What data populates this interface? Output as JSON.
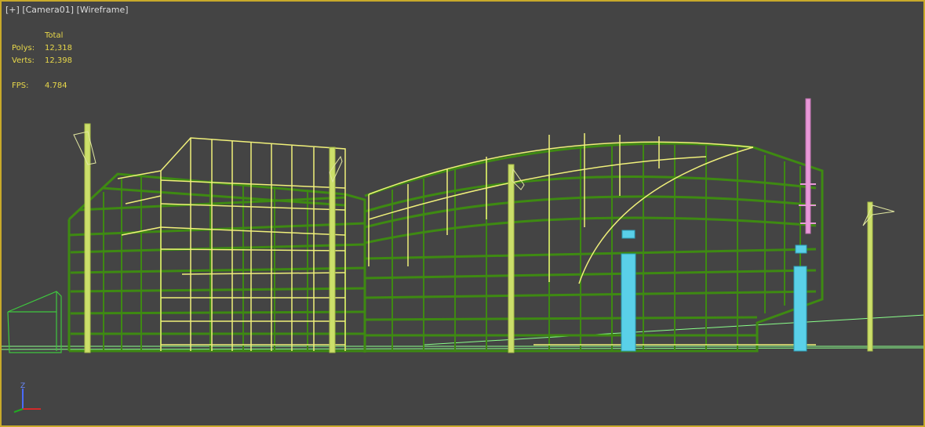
{
  "viewport": {
    "label_plus": "[+]",
    "label_camera": "[Camera01]",
    "label_mode": "[Wireframe]"
  },
  "stats": {
    "header": "Total",
    "polys_label": "Polys:",
    "polys_value": "12,318",
    "verts_label": "Verts:",
    "verts_value": "12,398",
    "fps_label": "FPS:",
    "fps_value": "4.784"
  },
  "colors": {
    "background": "#444444",
    "border": "#c8a92a",
    "dark_green": "#3e8a12",
    "light_green": "#ccdf6a",
    "yellow": "#f0f07a",
    "cyan": "#5ad0e8",
    "pink": "#e898d8",
    "ground": "#8aff8a"
  },
  "gizmo": {
    "z_label": "Z",
    "icon": "axis-gizmo-icon"
  }
}
